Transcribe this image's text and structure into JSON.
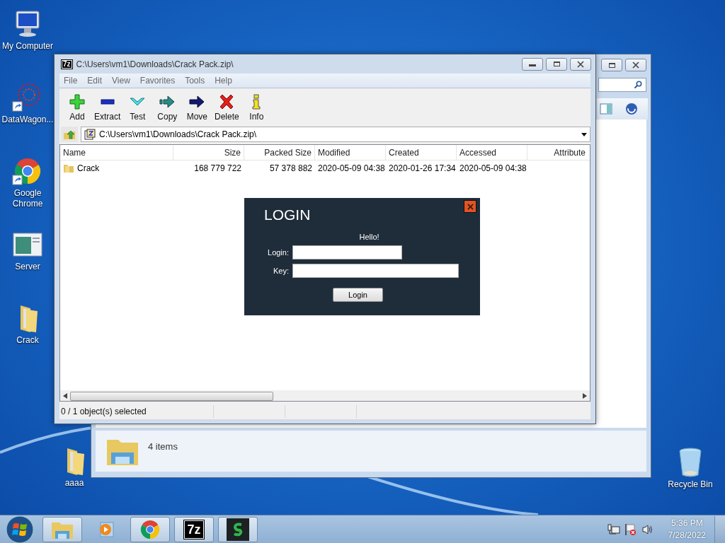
{
  "desktop": {
    "icons": [
      {
        "label": "My Computer",
        "kind": "computer",
        "shortcut": false
      },
      {
        "label": "DataWagon...",
        "kind": "network",
        "shortcut": true
      },
      {
        "label": "Google Chrome",
        "kind": "chrome",
        "shortcut": true
      },
      {
        "label": "Server",
        "kind": "server",
        "shortcut": false
      },
      {
        "label": "Crack",
        "kind": "folder",
        "shortcut": false
      }
    ],
    "loose_icons": [
      {
        "label": "aaaa",
        "kind": "folder"
      },
      {
        "label": "Recycle Bin",
        "kind": "bin"
      }
    ]
  },
  "explorer": {
    "status": "4 items"
  },
  "archive_window": {
    "icon_text": "7z",
    "title": "C:\\Users\\vm1\\Downloads\\Crack Pack.zip\\",
    "menu": [
      "File",
      "Edit",
      "View",
      "Favorites",
      "Tools",
      "Help"
    ],
    "toolbar": [
      {
        "label": "Add",
        "kind": "add"
      },
      {
        "label": "Extract",
        "kind": "extract"
      },
      {
        "label": "Test",
        "kind": "test"
      },
      {
        "label": "Copy",
        "kind": "copy"
      },
      {
        "label": "Move",
        "kind": "move"
      },
      {
        "label": "Delete",
        "kind": "delete"
      },
      {
        "label": "Info",
        "kind": "info"
      }
    ],
    "address": "C:\\Users\\vm1\\Downloads\\Crack Pack.zip\\",
    "columns": [
      "Name",
      "Size",
      "Packed Size",
      "Modified",
      "Created",
      "Accessed",
      "Attribute"
    ],
    "rows": [
      [
        "Crack",
        "168 779 722",
        "57 378 882",
        "2020-05-09 04:38",
        "2020-01-26 17:34",
        "2020-05-09 04:38"
      ]
    ],
    "status_bar": "0 / 1 object(s) selected"
  },
  "login_dialog": {
    "title": "LOGIN",
    "greeting": "Hello!",
    "fields": [
      {
        "label": "Login:"
      },
      {
        "label": "Key:"
      }
    ],
    "button": "Login"
  },
  "taskbar": {
    "items": [
      {
        "kind": "explorer",
        "running": true
      },
      {
        "kind": "media",
        "running": false
      },
      {
        "kind": "chrome",
        "running": true
      },
      {
        "kind": "sevenzip",
        "running": true,
        "label": "7z"
      },
      {
        "kind": "app",
        "running": true
      }
    ],
    "time": "5:36 PM",
    "date": "7/28/2022"
  }
}
